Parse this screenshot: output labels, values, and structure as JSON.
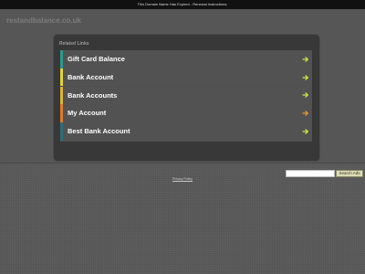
{
  "topbar": {
    "notice": "This Domain Name Has Expired - Renewal Instructions."
  },
  "header": {
    "domain": "restandbalance.co.uk"
  },
  "related": {
    "title": "Related Links",
    "items": [
      {
        "label": "Gift Card Balance",
        "accent": "#2b9a8c",
        "arrow_color": "#cfe34a"
      },
      {
        "label": "Bank Account",
        "accent": "#e2d23a",
        "arrow_color": "#cfe34a"
      },
      {
        "label": "Bank Accounts",
        "accent": "#d9b43a",
        "arrow_color": "#cfe34a"
      },
      {
        "label": "My Account",
        "accent": "#e07a2a",
        "arrow_color": "#e29a3a"
      },
      {
        "label": "Best Bank Account",
        "accent": "#2f6d7a",
        "arrow_color": "#cfe34a"
      }
    ],
    "arrow_icon": "arrow-right-icon"
  },
  "search": {
    "value": "",
    "placeholder": "",
    "button_label": "Search Ads"
  },
  "footer": {
    "privacy_label": "Privacy Policy"
  },
  "colors": {
    "page_background": "#5f5f5f",
    "topbar_background": "#111111",
    "panel_background": "#383838",
    "link_background": "#525252"
  }
}
